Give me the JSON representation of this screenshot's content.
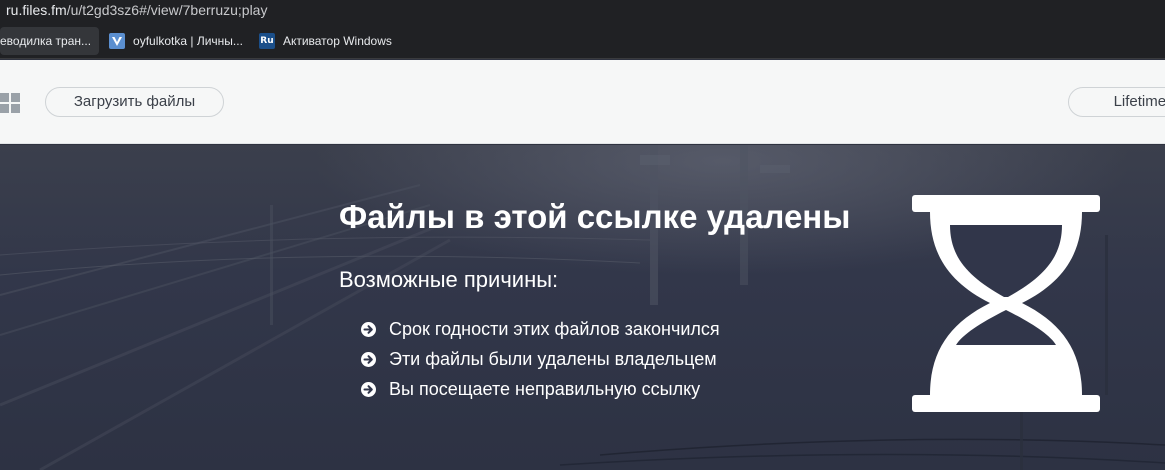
{
  "browser": {
    "url_host": "ru.files.fm",
    "url_path": "/u/t2gd3sz6#/view/7berruzu;play",
    "bookmarks": [
      {
        "label": "еводилка тран..."
      },
      {
        "label": "oyfulkotka | Личны..."
      },
      {
        "label": "Активатор Windows",
        "favicon_text": "Ru"
      }
    ]
  },
  "header": {
    "upload_label": "Загрузить файлы",
    "lifetime_label": "Lifetime St"
  },
  "hero": {
    "title": "Файлы в этой ссылке удалены",
    "subtitle": "Возможные причины:",
    "reasons": [
      "Срок годности этих файлов закончился",
      "Эти файлы были удалены владельцем",
      "Вы посещаете неправильную ссылку"
    ],
    "icon": "hourglass-icon"
  },
  "colors": {
    "hero_bg": "#30354a",
    "header_bg": "#f6f7f7",
    "chrome_bg": "#202124",
    "text_light": "#ffffff"
  }
}
